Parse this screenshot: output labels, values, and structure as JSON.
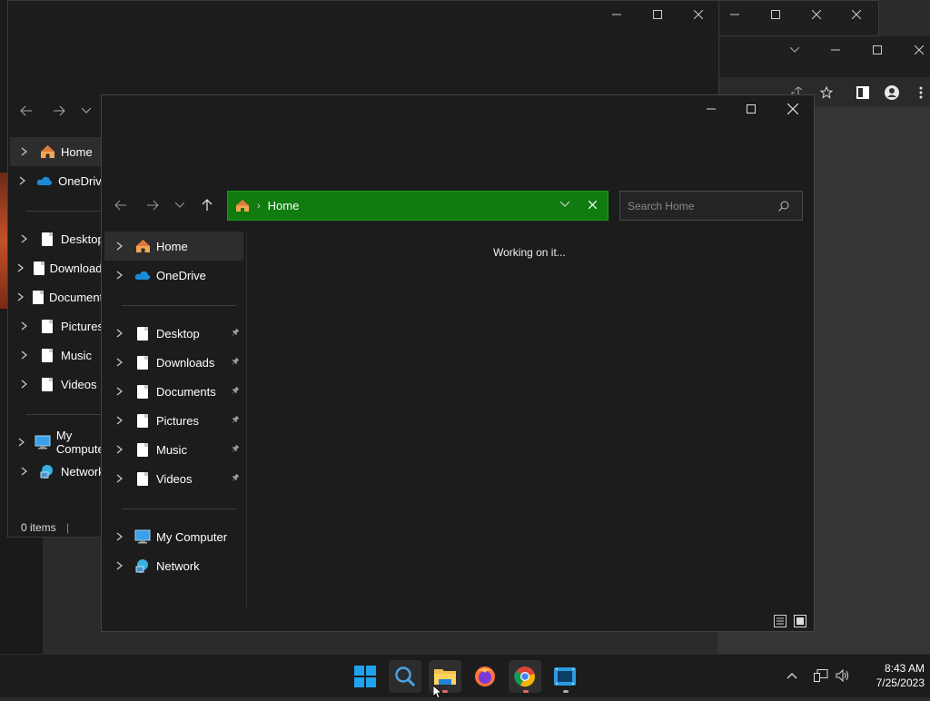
{
  "back_window": {
    "nav_items": [
      {
        "label": "Home"
      },
      {
        "label": "OneDrive"
      },
      {
        "label": "Desktop"
      },
      {
        "label": "Downloads"
      },
      {
        "label": "Documents"
      },
      {
        "label": "Pictures"
      },
      {
        "label": "Music"
      },
      {
        "label": "Videos"
      },
      {
        "label": "My Computer"
      },
      {
        "label": "Network"
      }
    ],
    "status": "0 items"
  },
  "main_window": {
    "address": {
      "location": "Home"
    },
    "search": {
      "placeholder": "Search Home"
    },
    "content_message": "Working on it...",
    "nav_items": [
      {
        "label": "Home"
      },
      {
        "label": "OneDrive"
      },
      {
        "label": "Desktop"
      },
      {
        "label": "Downloads"
      },
      {
        "label": "Documents"
      },
      {
        "label": "Pictures"
      },
      {
        "label": "Music"
      },
      {
        "label": "Videos"
      },
      {
        "label": "My Computer"
      },
      {
        "label": "Network"
      }
    ]
  },
  "taskbar": {
    "apps": [
      "windows-start",
      "search",
      "file-explorer",
      "firefox",
      "chrome",
      "media-app"
    ],
    "clock": {
      "time": "8:43 AM",
      "date": "7/25/2023"
    }
  },
  "colors": {
    "address_bar_bg": "#107c10",
    "window_bg": "#202020",
    "taskbar_bg": "#1c1c1c",
    "accent_blue": "#0078d4"
  }
}
